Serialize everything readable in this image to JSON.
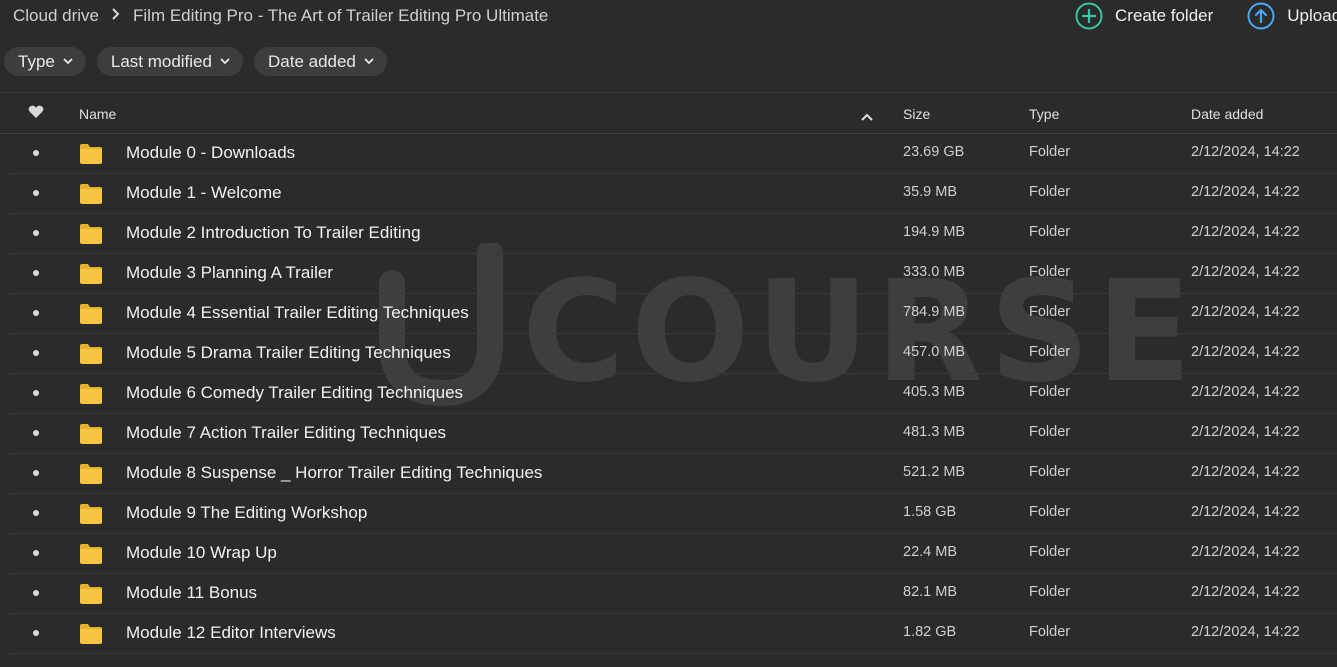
{
  "breadcrumb": {
    "root": "Cloud drive",
    "current": "Film Editing Pro - The Art of Trailer Editing Pro Ultimate"
  },
  "actions": {
    "create_folder": "Create folder",
    "upload": "Upload"
  },
  "filters": [
    "Type",
    "Last modified",
    "Date added"
  ],
  "table": {
    "columns": {
      "name": "Name",
      "size": "Size",
      "type": "Type",
      "date": "Date added"
    },
    "rows": [
      {
        "name": "Module 0 - Downloads",
        "size": "23.69 GB",
        "type": "Folder",
        "date": "2/12/2024, 14:22"
      },
      {
        "name": "Module 1 - Welcome",
        "size": "35.9 MB",
        "type": "Folder",
        "date": "2/12/2024, 14:22"
      },
      {
        "name": "Module 2 Introduction To Trailer Editing",
        "size": "194.9 MB",
        "type": "Folder",
        "date": "2/12/2024, 14:22"
      },
      {
        "name": "Module 3 Planning A Trailer",
        "size": "333.0 MB",
        "type": "Folder",
        "date": "2/12/2024, 14:22"
      },
      {
        "name": "Module 4 Essential Trailer Editing Techniques",
        "size": "784.9 MB",
        "type": "Folder",
        "date": "2/12/2024, 14:22"
      },
      {
        "name": "Module 5 Drama Trailer Editing Techniques",
        "size": "457.0 MB",
        "type": "Folder",
        "date": "2/12/2024, 14:22"
      },
      {
        "name": "Module 6 Comedy Trailer Editing Techniques",
        "size": "405.3 MB",
        "type": "Folder",
        "date": "2/12/2024, 14:22"
      },
      {
        "name": "Module 7 Action Trailer Editing Techniques",
        "size": "481.3 MB",
        "type": "Folder",
        "date": "2/12/2024, 14:22"
      },
      {
        "name": "Module 8 Suspense _ Horror Trailer Editing Techniques",
        "size": "521.2 MB",
        "type": "Folder",
        "date": "2/12/2024, 14:22"
      },
      {
        "name": "Module 9 The Editing Workshop",
        "size": "1.58 GB",
        "type": "Folder",
        "date": "2/12/2024, 14:22"
      },
      {
        "name": "Module 10 Wrap Up",
        "size": "22.4 MB",
        "type": "Folder",
        "date": "2/12/2024, 14:22"
      },
      {
        "name": "Module 11 Bonus",
        "size": "82.1 MB",
        "type": "Folder",
        "date": "2/12/2024, 14:22"
      },
      {
        "name": "Module 12 Editor Interviews",
        "size": "1.82 GB",
        "type": "Folder",
        "date": "2/12/2024, 14:22"
      }
    ]
  },
  "watermark": "COURSE",
  "icons": {
    "create": "plus-circle-icon",
    "upload": "arrow-up-circle-icon",
    "favourite": "heart-icon",
    "folder": "folder-icon",
    "sort": "chevron-up-icon"
  },
  "colors": {
    "background": "#2b2b2b",
    "create_accent": "#38c7a3",
    "upload_accent": "#4aa8f0",
    "folder": "#f5c542"
  }
}
